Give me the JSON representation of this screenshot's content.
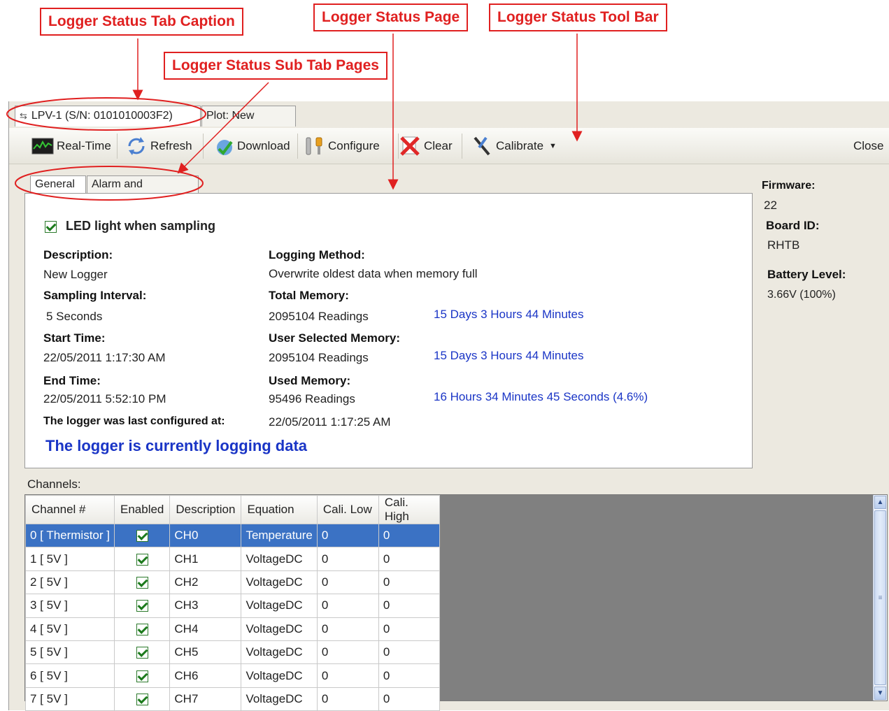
{
  "callouts": {
    "tab_caption": "Logger Status Tab Caption",
    "sub_tab_pages": "Logger Status Sub Tab Pages",
    "status_page": "Logger Status Page",
    "tool_bar": "Logger Status  Tool Bar"
  },
  "tabs": [
    {
      "label": "LPV-1 (S/N: 0101010003F2)",
      "icon": "usb-icon"
    },
    {
      "label": "Plot: New Logger"
    }
  ],
  "toolbar": {
    "real_time": "Real-Time",
    "refresh": "Refresh",
    "download": "Download",
    "configure": "Configure",
    "clear": "Clear",
    "calibrate": "Calibrate",
    "close": "Close"
  },
  "subtabs": [
    "General",
    "Alarm and Excitation"
  ],
  "general": {
    "led_label": "LED light when sampling",
    "led_checked": true,
    "description_label": "Description:",
    "description_value": "New Logger",
    "sampling_label": "Sampling Interval:",
    "sampling_value": "5 Seconds",
    "start_label": "Start Time:",
    "start_value": "22/05/2011 1:17:30 AM",
    "end_label": "End Time:",
    "end_value": "22/05/2011 5:52:10 PM",
    "configured_label": "The logger was last configured at:",
    "configured_value": "22/05/2011 1:17:25 AM",
    "method_label": "Logging Method:",
    "method_value": "Overwrite oldest data when memory full",
    "total_label": "Total Memory:",
    "total_value": "2095104 Readings",
    "total_duration": "15 Days 3 Hours 44 Minutes",
    "user_label": "User Selected Memory:",
    "user_value": "2095104 Readings",
    "user_duration": "15 Days 3 Hours 44 Minutes",
    "used_label": "Used Memory:",
    "used_value": "95496 Readings",
    "used_duration": "16 Hours 34 Minutes 45 Seconds (4.6%)",
    "status_message": "The logger is currently logging data"
  },
  "side": {
    "firmware_label": "Firmware:",
    "firmware_value": "22",
    "board_label": "Board ID:",
    "board_value": "RHTB",
    "battery_label": "Battery Level:",
    "battery_value": "3.66V (100%)"
  },
  "channels": {
    "label": "Channels:",
    "columns": [
      "Channel #",
      "Enabled",
      "Description",
      "Equation",
      "Cali. Low",
      "Cali. High"
    ],
    "rows": [
      {
        "channel": "0 [ Thermistor ]",
        "enabled": true,
        "description": "CH0",
        "equation": "Temperature",
        "cali_low": "0",
        "cali_high": "0",
        "selected": true
      },
      {
        "channel": "1 [ 5V ]",
        "enabled": true,
        "description": "CH1",
        "equation": "VoltageDC",
        "cali_low": "0",
        "cali_high": "0"
      },
      {
        "channel": "2 [ 5V ]",
        "enabled": true,
        "description": "CH2",
        "equation": "VoltageDC",
        "cali_low": "0",
        "cali_high": "0"
      },
      {
        "channel": "3 [ 5V ]",
        "enabled": true,
        "description": "CH3",
        "equation": "VoltageDC",
        "cali_low": "0",
        "cali_high": "0"
      },
      {
        "channel": "4 [ 5V ]",
        "enabled": true,
        "description": "CH4",
        "equation": "VoltageDC",
        "cali_low": "0",
        "cali_high": "0"
      },
      {
        "channel": "5 [ 5V ]",
        "enabled": true,
        "description": "CH5",
        "equation": "VoltageDC",
        "cali_low": "0",
        "cali_high": "0"
      },
      {
        "channel": "6 [ 5V ]",
        "enabled": true,
        "description": "CH6",
        "equation": "VoltageDC",
        "cali_low": "0",
        "cali_high": "0"
      },
      {
        "channel": "7 [ 5V ]",
        "enabled": true,
        "description": "CH7",
        "equation": "VoltageDC",
        "cali_low": "0",
        "cali_high": "0"
      }
    ]
  },
  "colors": {
    "annotation": "#e02020",
    "link": "#1a35c6",
    "selection": "#3b72c4"
  }
}
